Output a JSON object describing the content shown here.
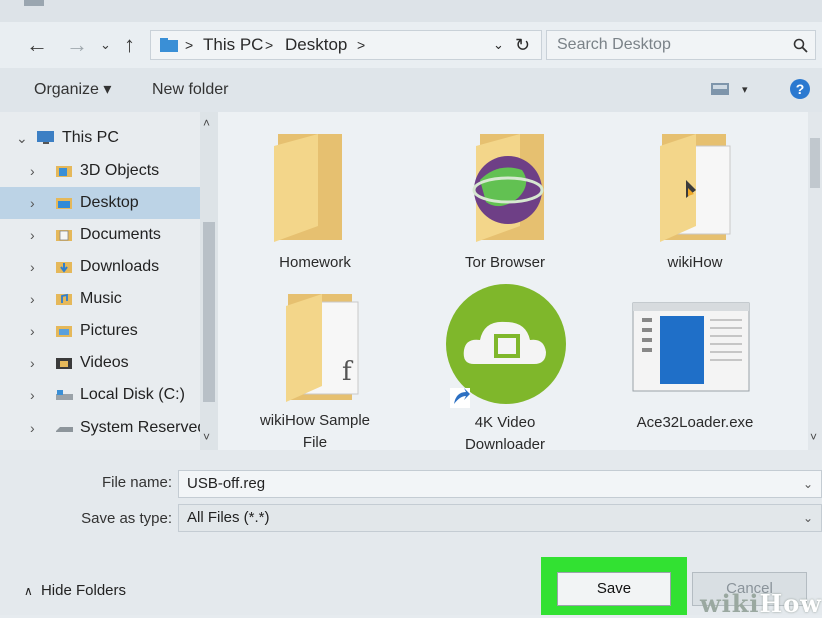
{
  "nav": {
    "back_icon": "arrow-left-icon",
    "forward_icon": "arrow-right-icon",
    "recent_icon": "chevron-down-icon",
    "up_icon": "arrow-up-icon",
    "breadcrumb": [
      "This PC",
      "Desktop"
    ],
    "refresh_icon": "refresh-icon",
    "search_placeholder": "Search Desktop"
  },
  "toolbar": {
    "organize": "Organize ▾",
    "new_folder": "New folder",
    "help": "?"
  },
  "tree": [
    {
      "label": "This PC",
      "icon": "pc-icon",
      "level": 0,
      "expanded": true
    },
    {
      "label": "3D Objects",
      "icon": "3d-objects-icon",
      "level": 1
    },
    {
      "label": "Desktop",
      "icon": "desktop-icon",
      "level": 1,
      "selected": true
    },
    {
      "label": "Documents",
      "icon": "documents-icon",
      "level": 1
    },
    {
      "label": "Downloads",
      "icon": "downloads-icon",
      "level": 1
    },
    {
      "label": "Music",
      "icon": "music-icon",
      "level": 1
    },
    {
      "label": "Pictures",
      "icon": "pictures-icon",
      "level": 1
    },
    {
      "label": "Videos",
      "icon": "videos-icon",
      "level": 1
    },
    {
      "label": "Local Disk (C:)",
      "icon": "local-disk-icon",
      "level": 1
    },
    {
      "label": "System Reserved",
      "icon": "drive-icon",
      "level": 1
    }
  ],
  "files": [
    {
      "name": "Homework",
      "type": "folder"
    },
    {
      "name": "Tor Browser",
      "type": "folder"
    },
    {
      "name": "wikiHow",
      "type": "folder"
    },
    {
      "name_line1": "wikiHow Sample",
      "name_line2": "File",
      "type": "folder"
    },
    {
      "name_line1": "4K Video",
      "name_line2": "Downloader",
      "type": "shortcut"
    },
    {
      "name": "Ace32Loader.exe",
      "type": "exe"
    }
  ],
  "form": {
    "file_name_label": "File name:",
    "file_name_value": "USB-off.reg",
    "save_type_label": "Save as type:",
    "save_type_value": "All Files  (*.*)"
  },
  "footer": {
    "hide_folders": "Hide Folders",
    "save": "Save",
    "cancel": "Cancel"
  },
  "watermark": {
    "part1": "wiki",
    "part2": "How"
  },
  "colors": {
    "selection": "#bcd3e6",
    "highlight": "#32e132",
    "folder": "#f0cf78"
  }
}
